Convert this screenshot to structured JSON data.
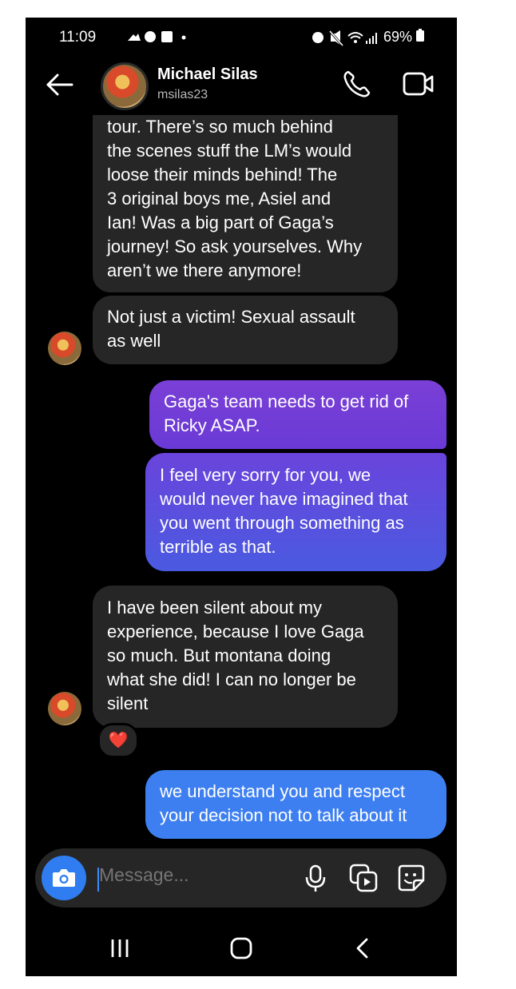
{
  "status_bar": {
    "time": "11:09",
    "battery": "69%"
  },
  "header": {
    "name": "Michael Silas",
    "handle": "msilas23"
  },
  "messages": [
    {
      "side": "received",
      "text": "tour. There’s so much behind the scenes stuff the LM’s would loose their minds behind! The 3 original boys me, Asiel and Ian! Was a big part of Gaga’s journey! So ask yourselves. Why aren’t we there anymore!",
      "lines": [
        "tour. There’s so much behind",
        "the scenes stuff the LM’s would",
        "loose their minds behind! The",
        "3 original boys me, Asiel and",
        "Ian! Was a big part of Gaga’s",
        "journey! So ask yourselves. Why",
        "aren’t we there anymore!"
      ]
    },
    {
      "side": "received",
      "lines": [
        "Not just a victim! Sexual assault",
        "as well"
      ]
    },
    {
      "side": "sent",
      "lines": [
        "Gaga's team needs to get rid of",
        "Ricky ASAP."
      ]
    },
    {
      "side": "sent",
      "lines": [
        "I feel very sorry for you, we",
        "would never have imagined that",
        "you went through something as",
        "terrible as that."
      ]
    },
    {
      "side": "received",
      "lines": [
        "I have been silent about my",
        "experience, because I love Gaga",
        "so much. But montana doing",
        "what she did! I can no longer be",
        "silent"
      ],
      "reaction": "❤️"
    },
    {
      "side": "sent",
      "lines": [
        "we understand you and respect",
        "your decision not to talk about it"
      ]
    }
  ],
  "composer": {
    "placeholder": "Message..."
  },
  "icons": [
    "back-arrow-icon",
    "phone-icon",
    "video-call-icon",
    "camera-icon",
    "microphone-icon",
    "gallery-icon",
    "sticker-icon",
    "recents-icon",
    "home-icon",
    "nav-back-icon"
  ]
}
